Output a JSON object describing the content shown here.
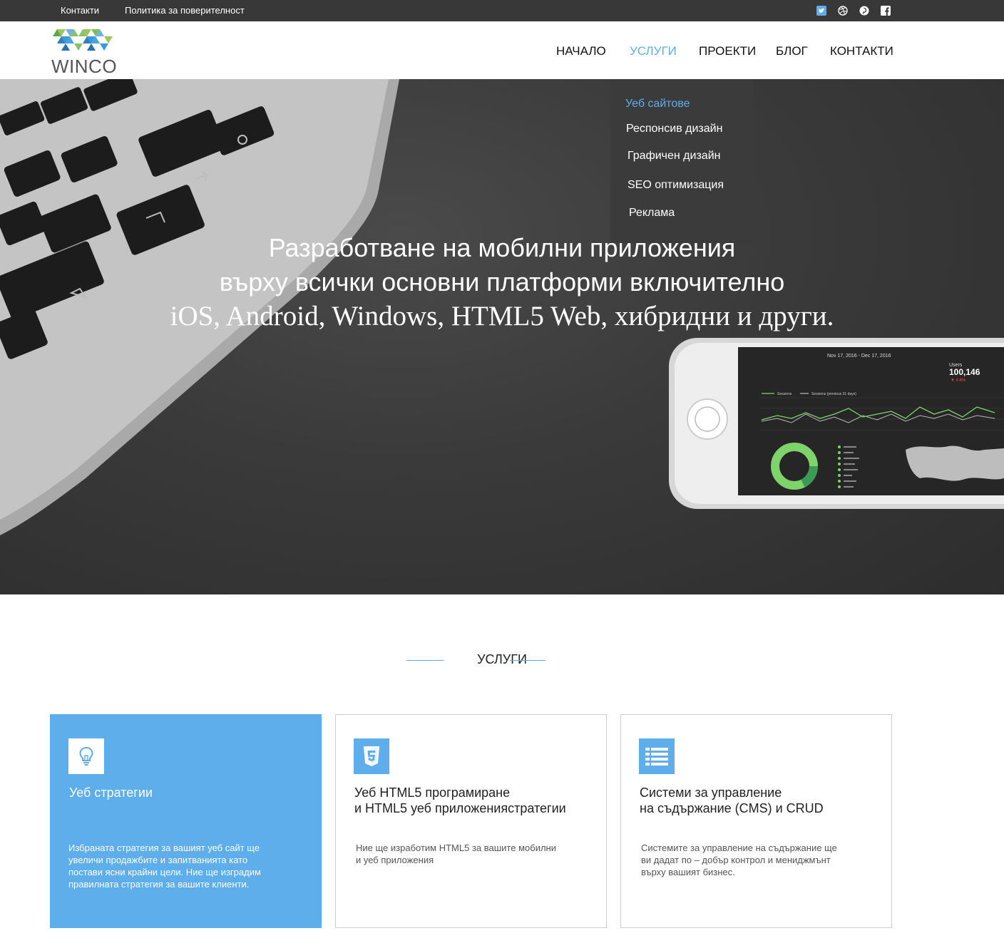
{
  "topbar": {
    "links": [
      "Контакти",
      "Политика за поверителност"
    ],
    "social_icons": [
      "twitter-icon",
      "dribbble-icon",
      "pinterest-icon",
      "facebook-icon"
    ]
  },
  "header": {
    "logo_text": "WINCO",
    "nav": [
      "НАЧАЛО",
      "УСЛУГИ",
      "ПРОЕКТИ",
      "БЛОГ",
      "КОНТАКТИ"
    ],
    "active_nav": "УСЛУГИ"
  },
  "dropdown": {
    "items": [
      "Уеб сайтове",
      "Респонсив дизайн",
      "Графичен дизайн",
      "SEO оптимизация",
      "Реклама"
    ],
    "active_item": "Уеб сайтове"
  },
  "hero": {
    "line1": "Разработване на мобилни приложения",
    "line2": "върху всички основни платформи включително",
    "line3": "iOS, Android, Windows, HTML5 Web, хибридни и други."
  },
  "phone_screen": {
    "date_range": "Nov 17, 2016 - Dec 17, 2016",
    "users_label": "Users",
    "users_value": "100,146",
    "users_change": "▼ 4.6%",
    "legend": [
      "Sessions",
      "Sessions (previous 31 days)"
    ]
  },
  "services": {
    "title": "УСЛУГИ",
    "cards": [
      {
        "icon": "lightbulb-icon",
        "title": "Уеб стратегии",
        "text": "Избраната стратегия за вашият уеб сайт ще увеличи продажбите и запитванията като постави ясни крайни цели. Ние ще изградим правилната стратегия за вашите клиенти."
      },
      {
        "icon": "html5-icon",
        "title_line1": "Уеб HTML5 програмиране",
        "title_line2": "и HTML5 уеб приложениястратегии",
        "text_line1": "Ние ще изработим HTML5 за вашите мобилни",
        "text_line2": "и уеб приложения"
      },
      {
        "icon": "list-icon",
        "title_line1": "Системи за управление",
        "title_line2": "на съдържание (CMS) и CRUD",
        "text_line1": "Системите за управление на съдържание ще",
        "text_line2": "ви дадат по – добър контрол и мениджмънт",
        "text_line3": "върху вашият бизнес."
      }
    ]
  },
  "colors": {
    "accent": "#5daeea",
    "topbar": "#383838",
    "dropdown": "#3b3b3b"
  }
}
